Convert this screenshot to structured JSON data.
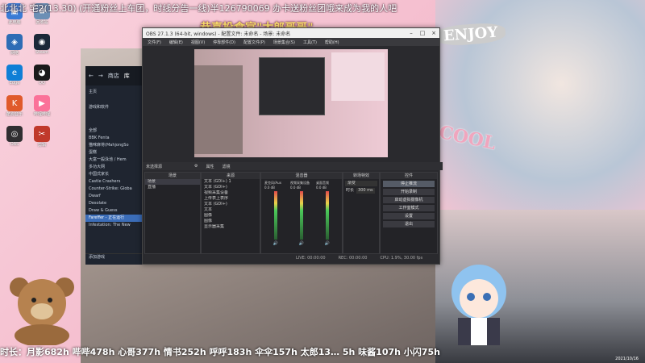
{
  "marquee": "北北北 宅2(13.30) (开通粉丝上车团，时线分告一线)半126790069 办卡送粉丝团哦来成为我的人吧",
  "headline": "恭喜投食官\"太郎哥哥\"",
  "sticker_enjoy": "ENJOY",
  "sticker_cool": "COOL",
  "bottom_stats": "时长：月影682h 哔哔478h 心哥377h 情书252h 呼呼183h 伞伞157h 太郎13… 5h 味酱107h 小闪75h",
  "clock_date": "2021/10/16",
  "desktop_icons": [
    {
      "label": "此电脑",
      "color": "#3a7bd5",
      "glyph": "▣"
    },
    {
      "label": "回收站",
      "color": "#6c8fb5",
      "glyph": "♻"
    },
    {
      "label": "网络",
      "color": "#2e6db5",
      "glyph": "◈"
    },
    {
      "label": "Steam",
      "color": "#1b2838",
      "glyph": "◉"
    },
    {
      "label": "Edge",
      "color": "#0f7fd6",
      "glyph": "e"
    },
    {
      "label": "QQ",
      "color": "#1a1a1a",
      "glyph": "◕"
    },
    {
      "label": "酷狗音乐",
      "color": "#e05a2b",
      "glyph": "K"
    },
    {
      "label": "哔哩哔哩",
      "color": "#fb7299",
      "glyph": "▶"
    },
    {
      "label": "OBS",
      "color": "#302e31",
      "glyph": "◎"
    },
    {
      "label": "剪辑",
      "color": "#c0392b",
      "glyph": "✂"
    }
  ],
  "store": {
    "nav_back": "←",
    "nav_forward": "→",
    "tab_store": "商店",
    "tab_library": "库",
    "home": "主页",
    "section": "游戏和软件",
    "all": "全部",
    "games": [
      "BBK Fenta",
      "猫咪麻将(MahjongSo",
      "蛋糕",
      "大富一般泳池 / Hem",
      "多功大网",
      "中国式家长",
      "Castle Crashers",
      "Counter-Strike: Globa",
      "Dwarf",
      "Desolate",
      "Draw & Guess",
      "Fareffer - 正在运行",
      "Infestation: The New"
    ],
    "selected_index": 11,
    "add_game": "添加游戏"
  },
  "obs": {
    "title": "OBS 27.1.3 (64-bit, windows) - 配置文件: 未命名 - 场景: 未命名",
    "menu": [
      "文件(F)",
      "编辑(E)",
      "视图(V)",
      "停靠部件(D)",
      "配置文件(P)",
      "场景集合(S)",
      "工具(T)",
      "帮助(H)"
    ],
    "toolbar": {
      "scene_label": "未选择源",
      "props": "属性",
      "filters": "滤镜"
    },
    "scenes_header": "场景",
    "scenes": [
      "场景",
      "直播"
    ],
    "sources_header": "来源",
    "sources": [
      "文本 (GDI+) 1",
      "文本 (GDI+)",
      "视频采集设备",
      "上传表上表序",
      "文本 (GDI+)",
      "文本",
      "图像",
      "图像",
      "显示器采集"
    ],
    "mixer_header": "混音器",
    "mixer_channels": [
      {
        "name": "麦克风/Aux",
        "db": "0.0 dB"
      },
      {
        "name": "视频采集设备",
        "db": "0.0 dB"
      },
      {
        "name": "桌面音频",
        "db": "0.0 dB"
      }
    ],
    "transitions_header": "转场特效",
    "transition_type": "渐变",
    "duration_label": "时长",
    "duration_value": "300 ms",
    "controls_header": "控件",
    "controls": [
      "停止推流",
      "开始录制",
      "启动虚拟摄像机",
      "工作室模式",
      "设置",
      "退出"
    ],
    "highlight_index": 0,
    "status": {
      "live": "LIVE: 00:00:00",
      "rec": "REC: 00:00:00",
      "cpu": "CPU: 1.9%, 30.00 fps"
    }
  }
}
